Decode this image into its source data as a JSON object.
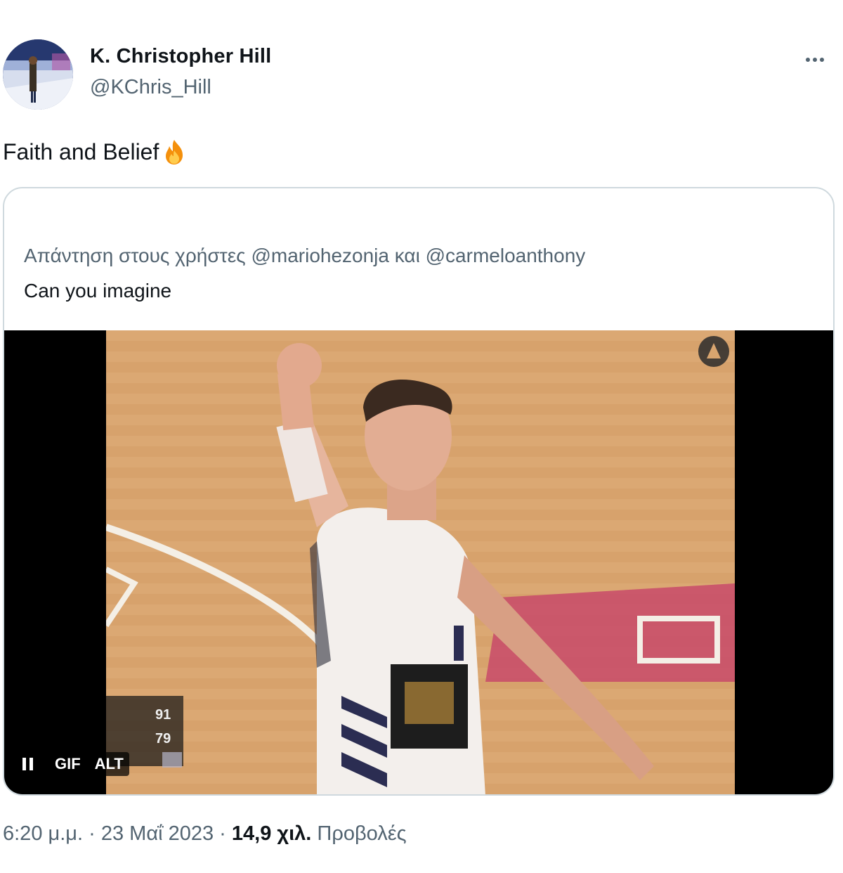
{
  "author": {
    "display_name": "K. Christopher Hill",
    "handle": "@KChris_Hill",
    "avatar_icon": "profile-photo"
  },
  "more_icon": "more-options-icon",
  "tweet": {
    "text": "Faith and Belief",
    "emoji_icon": "fire-emoji-icon"
  },
  "quote": {
    "reply_prefix": "Απάντηση στους χρήστες",
    "mention_1": "@mariohezonja",
    "conjunction": "και",
    "mention_2": "@carmeloanthony",
    "text": "Can you imagine",
    "media": {
      "type": "gif",
      "gif_label": "GIF",
      "alt_label": "ALT",
      "scoreboard": [
        "91",
        "79"
      ]
    }
  },
  "meta": {
    "time": "6:20 μ.μ.",
    "separator": "·",
    "date": "23 Μαΐ 2023",
    "views_count": "14,9 χιλ.",
    "views_label": "Προβολές"
  },
  "colors": {
    "text_primary": "#0f1419",
    "text_secondary": "#536471",
    "border": "#cfd9de",
    "court": "#d9a56f"
  }
}
